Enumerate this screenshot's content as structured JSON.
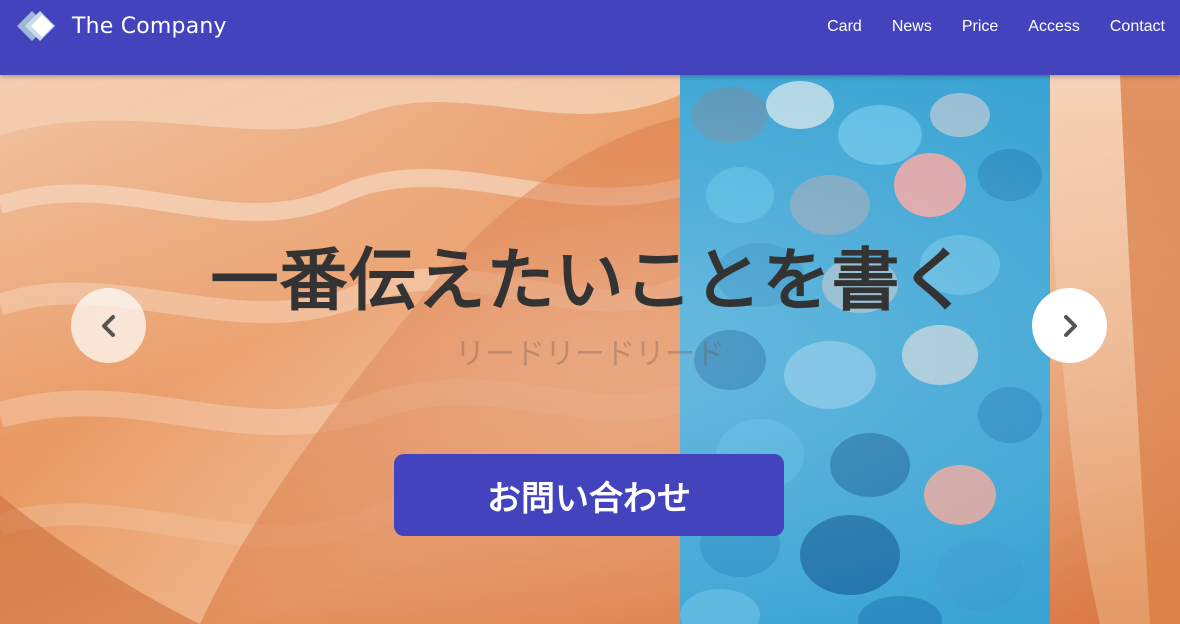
{
  "header": {
    "brand": "The Company",
    "background": "#4343bd",
    "nav": [
      "Card",
      "News",
      "Price",
      "Access",
      "Contact"
    ]
  },
  "hero": {
    "title": "一番伝えたいことを書く",
    "lead": "リードリードリード",
    "cta_label": "お問い合わせ",
    "prev_icon": "chevron-left-icon",
    "next_icon": "chevron-right-icon"
  }
}
